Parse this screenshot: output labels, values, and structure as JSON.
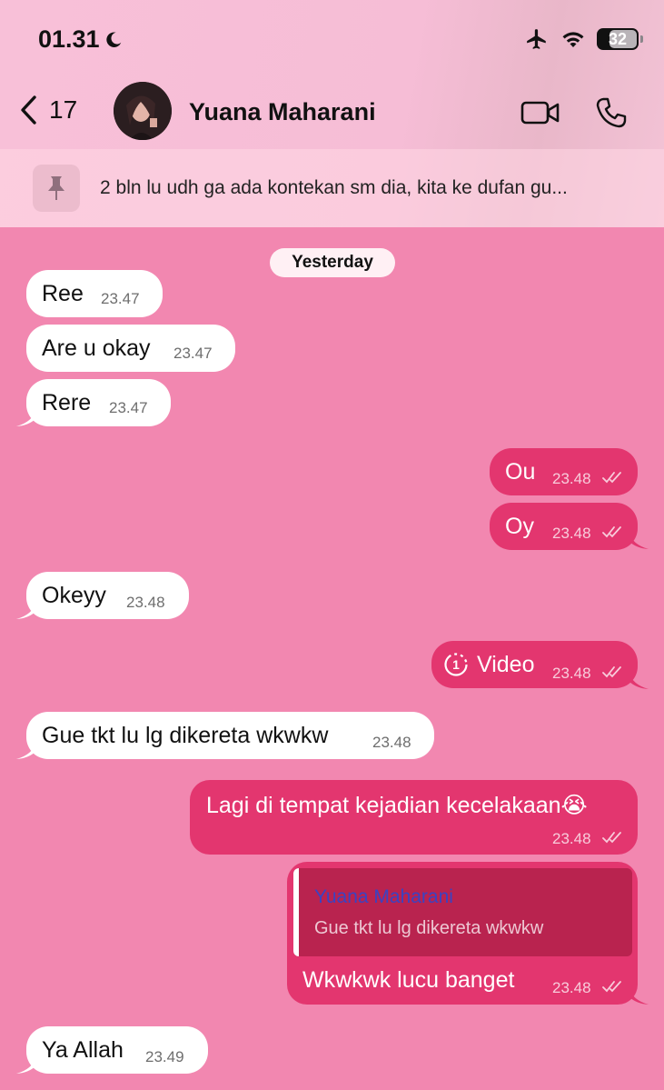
{
  "status_bar": {
    "time": "01.31",
    "battery": "32"
  },
  "nav": {
    "back_count": "17",
    "contact_name": "Yuana Maharani"
  },
  "pinned": {
    "text": "2 bln lu udh ga ada kontekan sm dia, kita ke dufan gu..."
  },
  "day_separator": "Yesterday",
  "messages": [
    {
      "dir": "in",
      "text": "Ree",
      "time": "23.47"
    },
    {
      "dir": "in",
      "text": "Are u okay",
      "time": "23.47"
    },
    {
      "dir": "in",
      "text": "Rere",
      "time": "23.47"
    },
    {
      "dir": "out",
      "text": "Ou",
      "time": "23.48"
    },
    {
      "dir": "out",
      "text": "Oy",
      "time": "23.48"
    },
    {
      "dir": "in",
      "text": "Okeyy",
      "time": "23.48"
    },
    {
      "dir": "out",
      "text": "Video",
      "time": "23.48"
    },
    {
      "dir": "in",
      "text": "Gue tkt lu lg dikereta wkwkw",
      "time": "23.48"
    },
    {
      "dir": "out",
      "text": "Lagi di tempat kejadian kecelakaan😭",
      "time": "23.48"
    },
    {
      "dir": "out",
      "text": "Wkwkwk lucu banget",
      "time": "23.48",
      "reply_to": {
        "name": "Yuana Maharani",
        "text": "Gue tkt lu lg dikereta wkwkw"
      }
    },
    {
      "dir": "in",
      "text": "Ya Allah",
      "time": "23.49"
    }
  ],
  "colors": {
    "chat_background": "#f287b0",
    "outgoing_bubble": "#e3366f",
    "incoming_bubble": "#ffffff",
    "reply_name": "#3a43c2"
  }
}
